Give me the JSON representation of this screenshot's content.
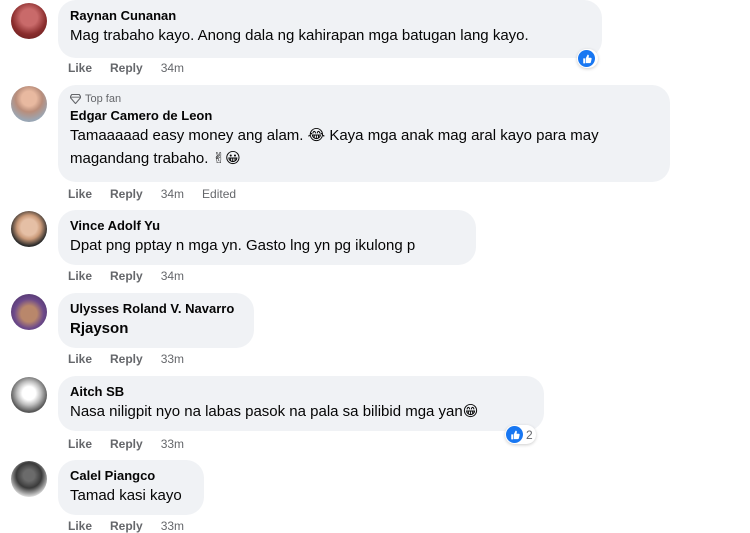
{
  "actions": {
    "like": "Like",
    "reply": "Reply"
  },
  "comments": [
    {
      "name": "Raynan Cunanan",
      "text": "Mag trabaho kayo. Anong dala ng kahirapan mga batugan lang kayo.",
      "time": "34m",
      "reactions": ""
    },
    {
      "badge": "Top fan",
      "name": "Edgar Camero de Leon",
      "line1": "Tamaaaaad easy money ang alam. 😂 Kaya mga anak mag aral kayo para may",
      "line2": "magandang trabaho. ✌😀",
      "time": "34m",
      "edited": "Edited"
    },
    {
      "name": "Vince Adolf Yu",
      "text": "Dpat png pptay n mga yn. Gasto lng yn pg ikulong p",
      "time": "34m"
    },
    {
      "name": "Ulysses Roland V. Navarro",
      "text": "Rjayson",
      "time": "33m"
    },
    {
      "name": "Aitch SB",
      "text": "Nasa niligpit nyo na labas pasok na pala sa bilibid mga yan😁",
      "time": "33m",
      "reactions": "2"
    },
    {
      "name": "Calel Piangco",
      "text": "Tamad kasi kayo",
      "time": "33m"
    }
  ],
  "colors": {
    "bubble": "#f0f2f5",
    "meta": "#65676b",
    "like_blue": "#1877f2"
  }
}
